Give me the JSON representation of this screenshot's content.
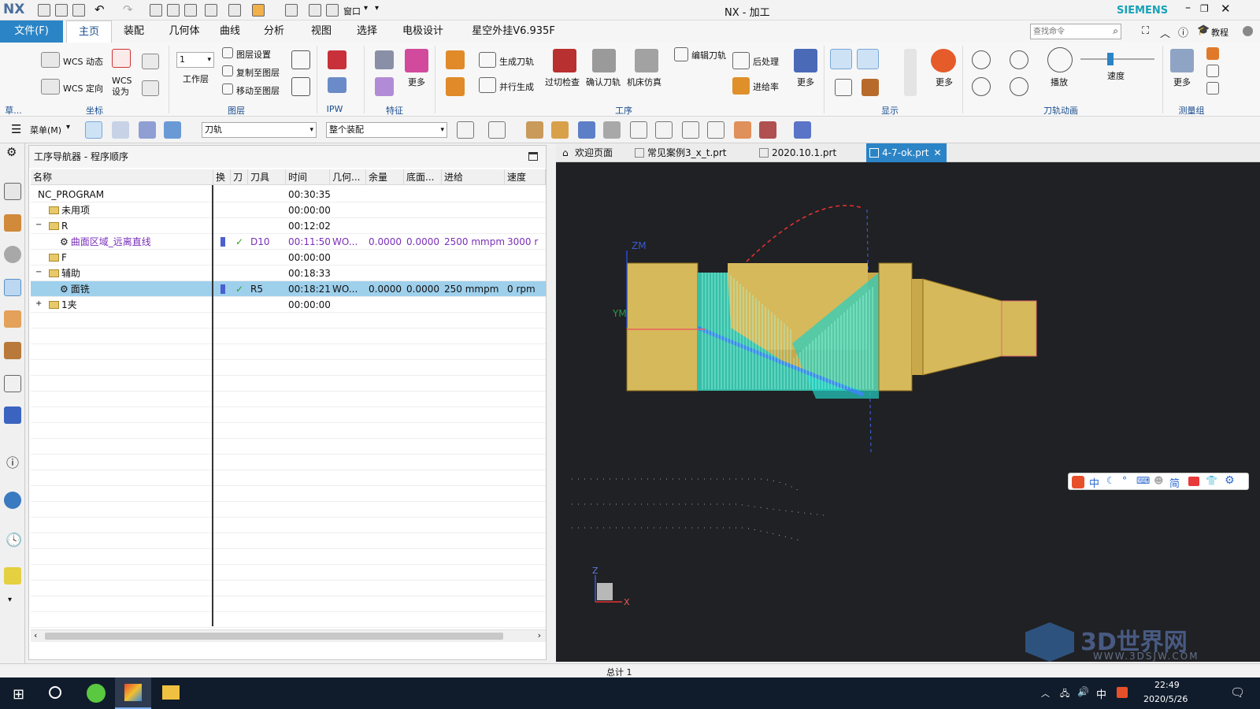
{
  "app": {
    "logo": "NX",
    "title": "NX - 加工",
    "brand": "SIEMENS",
    "window_menu_label": "窗口"
  },
  "menubar": {
    "file_label": "文件(F)",
    "tabs": [
      "主页",
      "装配",
      "几何体",
      "曲线",
      "分析",
      "视图",
      "选择",
      "电极设计",
      "星空外挂V6.935F"
    ],
    "search_placeholder": "查找命令",
    "tutorial_label": "教程"
  },
  "ribbon": {
    "groups": [
      "草...",
      "坐标",
      "图层",
      "IPW",
      "特征",
      "工序",
      "显示",
      "刀轨动画",
      "测量组"
    ],
    "wcs_dynamic": "WCS 动态",
    "wcs_orient": "WCS 定向",
    "wcs_set": "WCS\n设为",
    "work_layer_value": "1",
    "work_layer_label": "工作层",
    "layer_settings": "图层设置",
    "copy_to_layer": "复制至图层",
    "move_to_layer": "移动至图层",
    "more": "更多",
    "generate_toolpath": "生成刀轨",
    "parallel_generate": "并行生成",
    "gouge_check": "过切检查",
    "verify_toolpath": "确认刀轨",
    "machine_sim": "机床仿真",
    "edit_toolpath": "编辑刀轨",
    "post_process": "后处理",
    "feed_rate": "进给率",
    "play": "播放",
    "speed": "速度"
  },
  "toolbar2": {
    "menu_label": "菜单(M)",
    "filter_combo": "刀轨",
    "scope_combo": "整个装配"
  },
  "navigator": {
    "title": "工序导航器 - 程序顺序",
    "columns": [
      "名称",
      "换",
      "刀",
      "刀具",
      "时间",
      "几何...",
      "余量",
      "底面...",
      "进给",
      "速度"
    ],
    "rows": [
      {
        "name": "NC_PROGRAM",
        "tool": "",
        "time": "00:30:35",
        "geom": "",
        "stock": "",
        "floor": "",
        "feed": "",
        "speed": "",
        "indent": 0,
        "kind": "root"
      },
      {
        "name": "未用项",
        "tool": "",
        "time": "00:00:00",
        "geom": "",
        "stock": "",
        "floor": "",
        "feed": "",
        "speed": "",
        "indent": 1,
        "kind": "folder"
      },
      {
        "name": "R",
        "tool": "",
        "time": "00:12:02",
        "geom": "",
        "stock": "",
        "floor": "",
        "feed": "",
        "speed": "",
        "indent": 1,
        "kind": "folder"
      },
      {
        "name": "曲面区域_远离直线",
        "tool": "D10",
        "time": "00:11:50",
        "geom": "WO...",
        "stock": "0.0000",
        "floor": "0.0000",
        "feed": "2500 mmpm",
        "speed": "3000 r",
        "indent": 2,
        "kind": "op"
      },
      {
        "name": "F",
        "tool": "",
        "time": "00:00:00",
        "geom": "",
        "stock": "",
        "floor": "",
        "feed": "",
        "speed": "",
        "indent": 1,
        "kind": "folder"
      },
      {
        "name": "辅助",
        "tool": "",
        "time": "00:18:33",
        "geom": "",
        "stock": "",
        "floor": "",
        "feed": "",
        "speed": "",
        "indent": 1,
        "kind": "folder"
      },
      {
        "name": "面铣",
        "tool": "R5",
        "time": "00:18:21",
        "geom": "WO...",
        "stock": "0.0000",
        "floor": "0.0000",
        "feed": "250 mmpm",
        "speed": "0 rpm",
        "indent": 2,
        "kind": "op-selected"
      },
      {
        "name": "1夹",
        "tool": "",
        "time": "00:00:00",
        "geom": "",
        "stock": "",
        "floor": "",
        "feed": "",
        "speed": "",
        "indent": 1,
        "kind": "folder"
      }
    ]
  },
  "doc_tabs": [
    "欢迎页面",
    "常见案例3_x_t.prt",
    "2020.10.1.prt",
    "4-7-ok.prt"
  ],
  "viewport": {
    "axis_zm": "ZM",
    "axis_ym": "YM",
    "triad_z": "Z",
    "triad_x": "X"
  },
  "ime_bar": {
    "items": [
      "中",
      "简"
    ]
  },
  "status": {
    "total": "总计 1"
  },
  "watermark": {
    "text": "3D世界网",
    "sub": "WWW.3DSJW.COM"
  },
  "taskbar": {
    "time": "22:49",
    "date": "2020/5/26",
    "ime": "中"
  },
  "colors": {
    "accent": "#2b84c6",
    "selected_row": "#9ed0ec",
    "part_gold": "#d6b95a",
    "toolpath": "#22d0c4",
    "op_text": "#7a2fb8"
  }
}
